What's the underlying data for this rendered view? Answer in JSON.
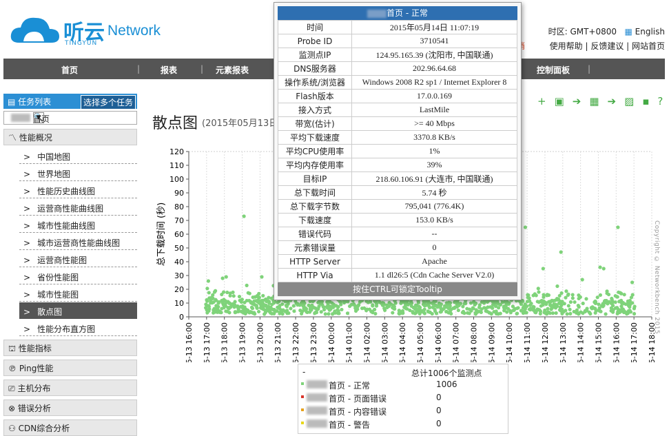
{
  "header": {
    "brand_cn": "听云",
    "brand_en": "Network",
    "brand_sub": "TINGYUN",
    "timezone": "时区: GMT+0800",
    "lang": "English",
    "logout": "注销",
    "links": "使用帮助 | 反馈建议 | 网站首页"
  },
  "nav": {
    "items": [
      "首页",
      "报表",
      "元素报表",
      "控制面板"
    ]
  },
  "sidebar": {
    "tasks_label": "任务列表",
    "multi_button": "选择多个任务",
    "search_value": "首页",
    "section_overview": "性能概况",
    "items": [
      "中国地图",
      "世界地图",
      "性能历史曲线图",
      "运营商性能曲线图",
      "城市性能曲线图",
      "城市运营商性能曲线图",
      "运营商性能图",
      "省份性能图",
      "城市性能图",
      "散点图",
      "性能分布直方图"
    ],
    "sections": [
      "性能指标",
      "Ping性能",
      "主机分布",
      "错误分析",
      "CDN综合分析"
    ]
  },
  "main": {
    "title": "散点图",
    "subtitle": "(2015年05月13日"
  },
  "chart_data": {
    "type": "scatter",
    "ylabel": "总下载时间 (秒)",
    "ylim": [
      0,
      120
    ],
    "yticks": [
      0,
      10,
      20,
      30,
      40,
      50,
      60,
      70,
      80,
      90,
      100,
      110,
      120
    ],
    "xticks": [
      "05-13 16:00",
      "05-13 17:00",
      "05-13 18:00",
      "05-13 19:00",
      "05-13 20:00",
      "05-13 21:00",
      "05-13 22:00",
      "05-13 23:00",
      "05-14 00:00",
      "05-14 01:00",
      "05-14 02:00",
      "05-14 03:00",
      "05-14 04:00",
      "05-14 05:00",
      "05-14 06:00",
      "05-14 07:00",
      "05-14 08:00",
      "05-14 09:00",
      "05-14 10:00",
      "05-14 11:00",
      "05-14 12:00",
      "05-14 13:00",
      "05-14 14:00",
      "05-14 15:00",
      "05-14 16:00",
      "05-14 17:00",
      "05-14 18:00"
    ],
    "series": [
      {
        "name": "首页 - 正常",
        "color": "#7fd37a",
        "outliers": [
          [
            1.1,
            26
          ],
          [
            1.9,
            28
          ],
          [
            2.1,
            29
          ],
          [
            3.1,
            73
          ],
          [
            4.1,
            29
          ],
          [
            4.9,
            42
          ],
          [
            5.3,
            35
          ],
          [
            6.1,
            22
          ],
          [
            9.1,
            20
          ],
          [
            12.2,
            20
          ],
          [
            15.1,
            25
          ],
          [
            18.9,
            65
          ],
          [
            19.9,
            35
          ],
          [
            20.9,
            47
          ],
          [
            22.1,
            27
          ],
          [
            23.1,
            36
          ],
          [
            23.3,
            35
          ],
          [
            24.1,
            65
          ],
          [
            24.9,
            25
          ]
        ]
      }
    ],
    "copyright": "Copyright © Networkbench 2015"
  },
  "legend": {
    "dash": "-",
    "total_label": "总计1006个监测点",
    "rows": [
      {
        "name": "首页 - 正常",
        "color": "#7fd37a",
        "count": "1006"
      },
      {
        "name": "首页 - 页面错误",
        "color": "#d9332a",
        "count": "0"
      },
      {
        "name": "首页 - 内容错误",
        "color": "#e8a21a",
        "count": "0"
      },
      {
        "name": "首页 - 警告",
        "color": "#e8d81a",
        "count": "0"
      }
    ]
  },
  "tooltip": {
    "title": "首页 - 正常",
    "footer": "按住CTRL可锁定Tooltip",
    "rows": [
      [
        "时间",
        "2015年05月14日 11:07:19"
      ],
      [
        "Probe ID",
        "3710541"
      ],
      [
        "监测点IP",
        "124.95.165.39 (沈阳市, 中国联通)"
      ],
      [
        "DNS服务器",
        "202.96.64.68"
      ],
      [
        "操作系统/浏览器",
        "Windows 2008 R2 sp1 / Internet Explorer 8"
      ],
      [
        "Flash版本",
        "17.0.0.169"
      ],
      [
        "接入方式",
        "LastMile"
      ],
      [
        "带宽(估计)",
        ">= 40 Mbps"
      ],
      [
        "平均下载速度",
        "3370.8 KB/s"
      ],
      [
        "平均CPU使用率",
        "1%"
      ],
      [
        "平均内存使用率",
        "39%"
      ],
      [
        "目标IP",
        "218.60.106.91 (大连市, 中国联通)"
      ],
      [
        "总下载时间",
        "5.74 秒"
      ],
      [
        "总下载字节数",
        "795,041 (776.4K)"
      ],
      [
        "下载速度",
        "153.0 KB/s"
      ],
      [
        "错误代码",
        "--"
      ],
      [
        "元素错误量",
        "0"
      ],
      [
        "HTTP Server",
        "Apache"
      ],
      [
        "HTTP Via",
        "1.1 dl26:5 (Cdn Cache Server V2.0)"
      ]
    ]
  }
}
